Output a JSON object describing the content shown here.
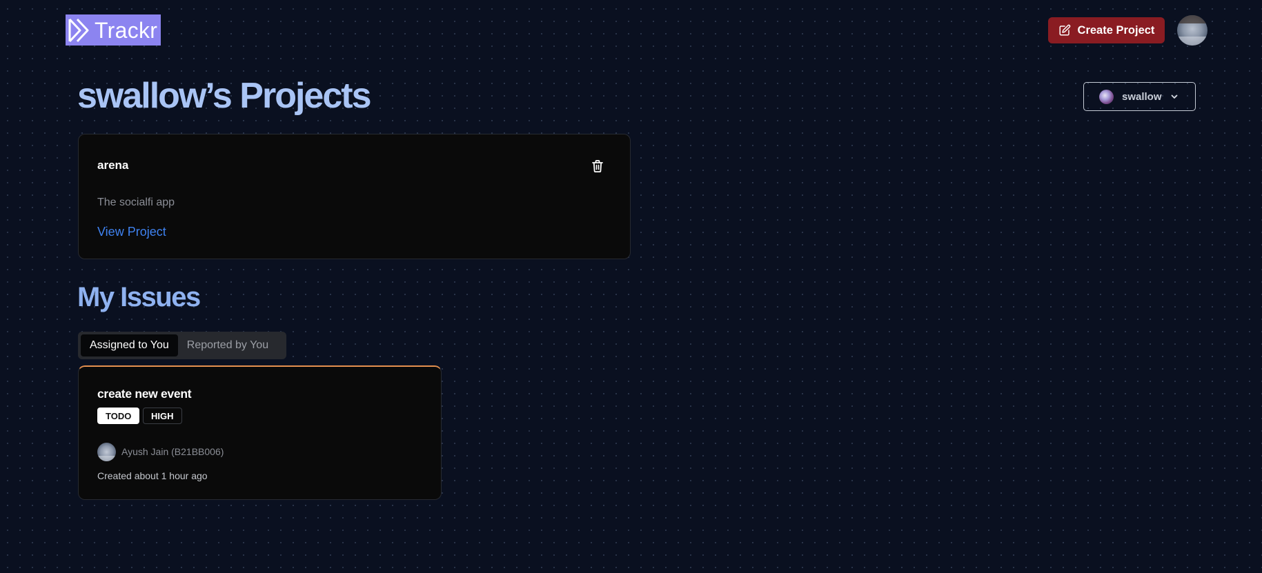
{
  "header": {
    "logo_text": "Trackr",
    "create_button_label": "Create Project",
    "create_icon": "edit-icon",
    "avatar_alt": "user-avatar"
  },
  "page": {
    "title": "swallow’s Projects"
  },
  "user_switcher": {
    "label": "swallow",
    "icon": "chevron-down-icon"
  },
  "projects": [
    {
      "name": "arena",
      "description": "The socialfi app",
      "link_label": "View Project",
      "delete_icon": "trash-icon"
    }
  ],
  "issues_section": {
    "title": "My Issues",
    "tabs": [
      {
        "label": "Assigned to You",
        "active": true
      },
      {
        "label": "Reported by You",
        "active": false
      }
    ]
  },
  "issues": [
    {
      "title": "create new event",
      "status": "TODO",
      "priority": "HIGH",
      "reporter": "Ayush Jain (B21BB006)",
      "created": "Created about 1 hour ago"
    }
  ],
  "colors": {
    "background": "#0a1020",
    "accent_red": "#8a1c22",
    "logo_bg": "#8c84f0",
    "link_blue": "#3f82f0",
    "title_blue": "#a9c4f5",
    "issue_border": "#e59050"
  }
}
